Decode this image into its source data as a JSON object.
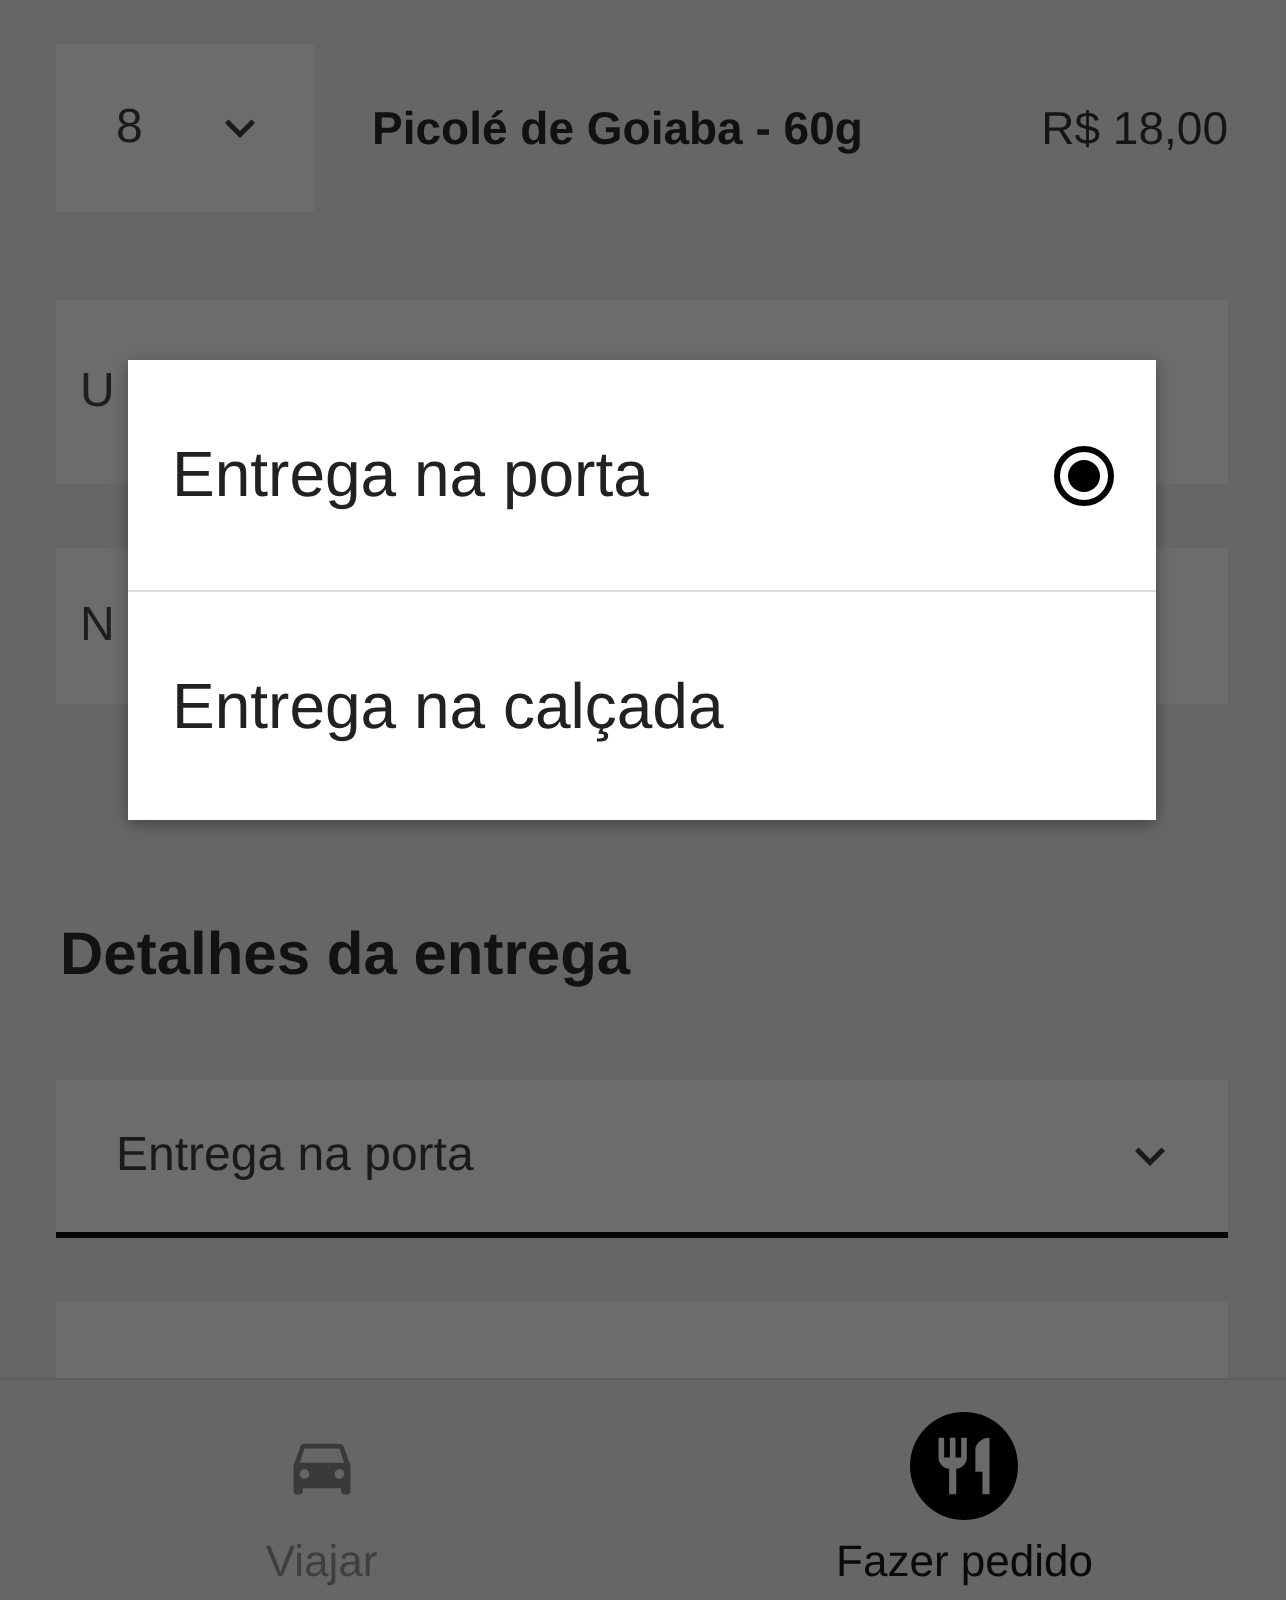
{
  "order_item": {
    "quantity": "8",
    "name": "Picolé de Goiaba - 60g",
    "price": "R$ 18,00"
  },
  "fields": [
    {
      "placeholder": "U"
    },
    {
      "placeholder": "N"
    }
  ],
  "delivery": {
    "heading": "Detalhes da entrega",
    "select_value": "Entrega na porta"
  },
  "dialog": {
    "options": [
      {
        "label": "Entrega na porta",
        "selected": true
      },
      {
        "label": "Entrega na calçada",
        "selected": false
      }
    ]
  },
  "bottom_nav": [
    {
      "label": "Viajar",
      "kind": "car",
      "selected": false
    },
    {
      "label": "Fazer pedido",
      "kind": "food",
      "selected": true
    }
  ]
}
